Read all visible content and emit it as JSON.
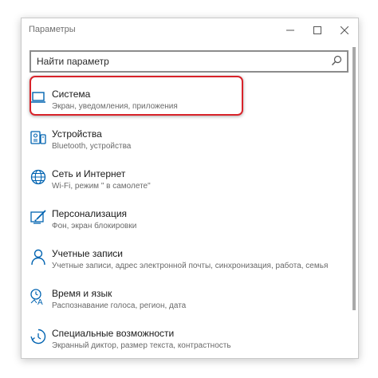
{
  "window": {
    "title": "Параметры",
    "controls": [
      "minimize",
      "maximize",
      "close"
    ]
  },
  "search": {
    "placeholder": "Найти параметр",
    "icon": "search-icon"
  },
  "items": [
    {
      "title": "Система",
      "subtitle": "Экран, уведомления, приложения",
      "icon": "laptop-icon"
    },
    {
      "title": "Устройства",
      "subtitle": "Bluetooth, устройства",
      "icon": "devices-icon"
    },
    {
      "title": "Сеть и Интернет",
      "subtitle": "Wi-Fi, режим \" в самолете\"",
      "icon": "globe-icon"
    },
    {
      "title": "Персонализация",
      "subtitle": "Фон, экран блокировки",
      "icon": "personalization-icon"
    },
    {
      "title": "Учетные записи",
      "subtitle": "Учетные записи, адрес электронной почты, синхронизация, работа, семья",
      "icon": "person-icon"
    },
    {
      "title": "Время и язык",
      "subtitle": "Распознавание голоса, регион, дата",
      "icon": "time-language-icon"
    },
    {
      "title": "Специальные возможности",
      "subtitle": "Экранный диктор, размер текста, контрастность",
      "icon": "accessibility-icon"
    }
  ],
  "colors": {
    "accent": "#0063b1",
    "highlight": "#d8232a"
  }
}
